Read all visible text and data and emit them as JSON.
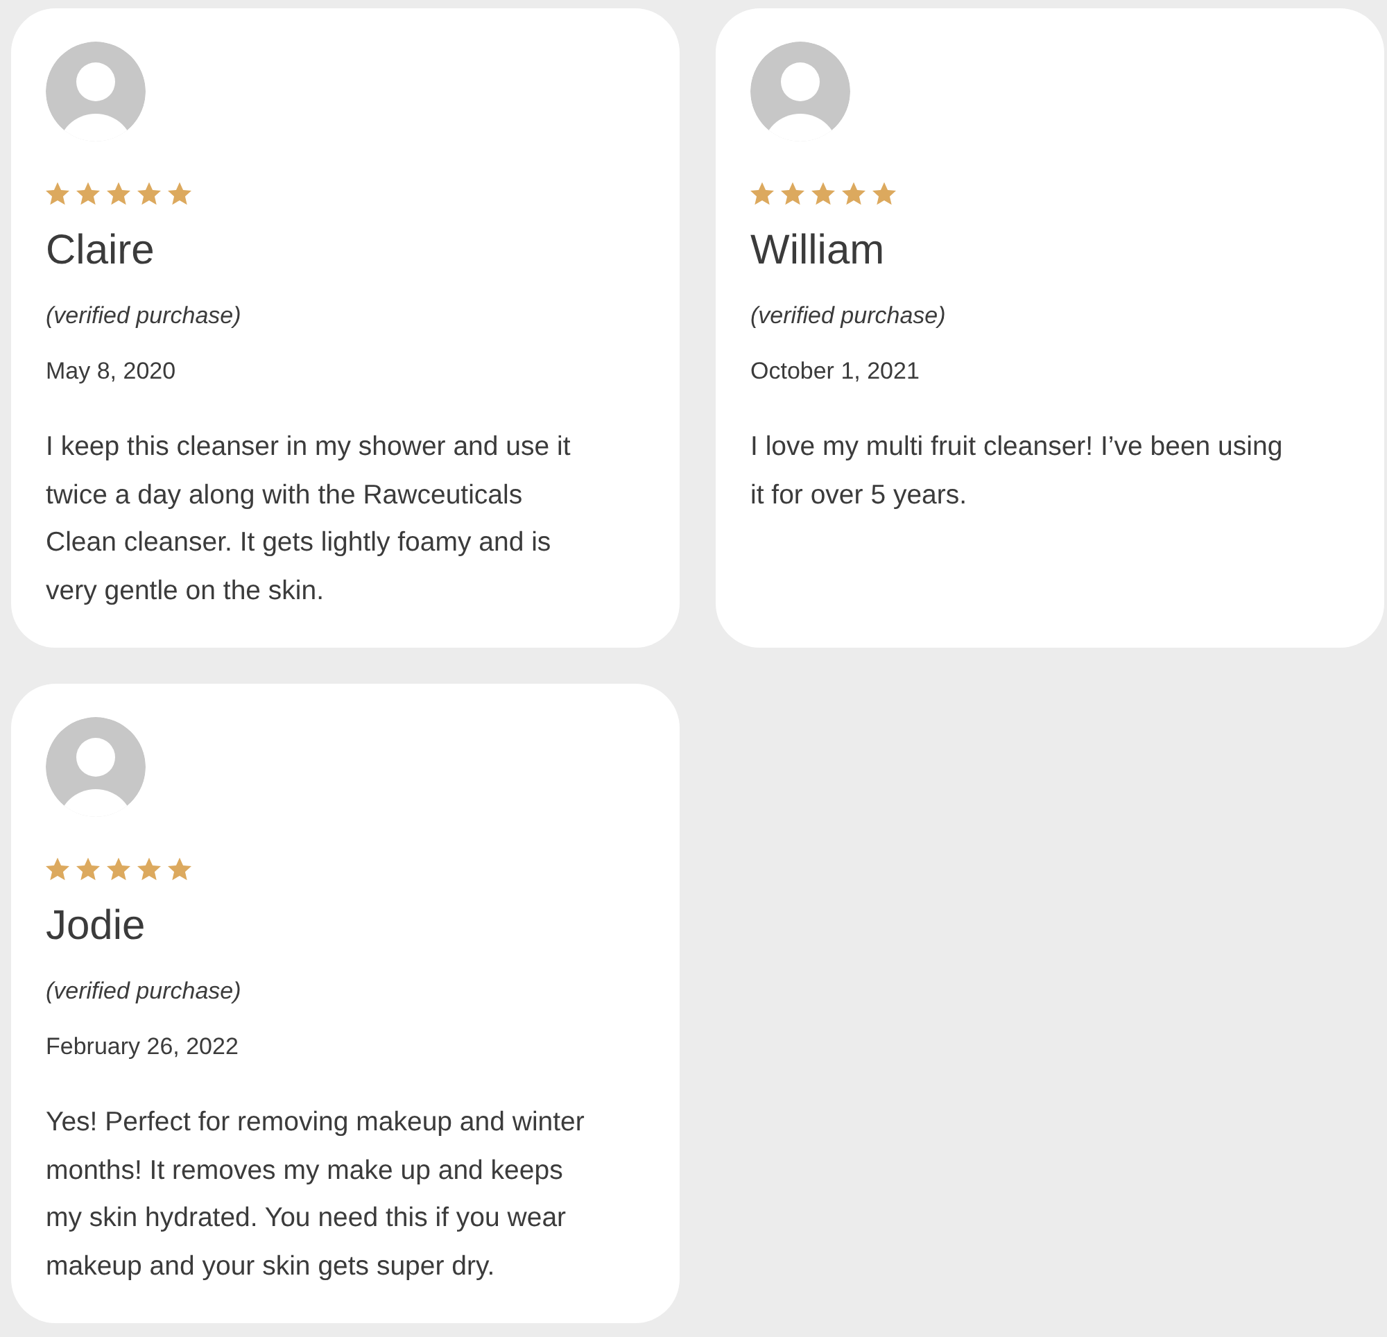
{
  "reviews": [
    {
      "name": "Claire",
      "stars": 5,
      "verified": "(verified purchase)",
      "date": "May 8, 2020",
      "text": "I keep this cleanser in my shower and use it twice a day along with the Rawceuticals Clean cleanser. It gets lightly foamy and is very gentle on the skin."
    },
    {
      "name": "William",
      "stars": 5,
      "verified": "(verified purchase)",
      "date": "October 1, 2021",
      "text": "I love my multi fruit cleanser! I’ve been using it for over 5 years."
    },
    {
      "name": "Jodie",
      "stars": 5,
      "verified": "(verified purchase)",
      "date": "February 26, 2022",
      "text": "Yes! Perfect for removing makeup and winter months! It removes my make up and keeps my skin hydrated. You need this if you wear makeup and your skin gets super dry."
    }
  ]
}
